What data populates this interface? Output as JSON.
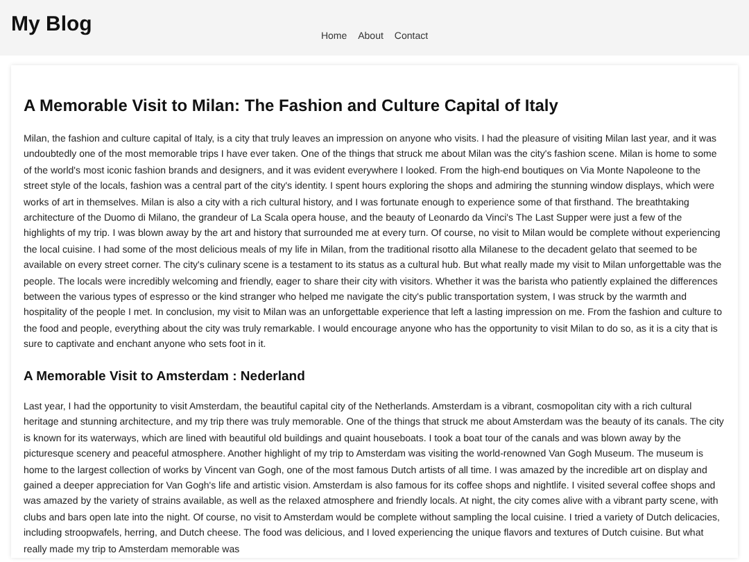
{
  "site_title": "My Blog",
  "nav": [
    {
      "label": "Home"
    },
    {
      "label": "About"
    },
    {
      "label": "Contact"
    }
  ],
  "posts": [
    {
      "title": "A Memorable Visit to Milan: The Fashion and Culture Capital of Italy",
      "body": "Milan, the fashion and culture capital of Italy, is a city that truly leaves an impression on anyone who visits. I had the pleasure of visiting Milan last year, and it was undoubtedly one of the most memorable trips I have ever taken. One of the things that struck me about Milan was the city's fashion scene. Milan is home to some of the world's most iconic fashion brands and designers, and it was evident everywhere I looked. From the high-end boutiques on Via Monte Napoleone to the street style of the locals, fashion was a central part of the city's identity. I spent hours exploring the shops and admiring the stunning window displays, which were works of art in themselves. Milan is also a city with a rich cultural history, and I was fortunate enough to experience some of that firsthand. The breathtaking architecture of the Duomo di Milano, the grandeur of La Scala opera house, and the beauty of Leonardo da Vinci's The Last Supper were just a few of the highlights of my trip. I was blown away by the art and history that surrounded me at every turn. Of course, no visit to Milan would be complete without experiencing the local cuisine. I had some of the most delicious meals of my life in Milan, from the traditional risotto alla Milanese to the decadent gelato that seemed to be available on every street corner. The city's culinary scene is a testament to its status as a cultural hub. But what really made my visit to Milan unforgettable was the people. The locals were incredibly welcoming and friendly, eager to share their city with visitors. Whether it was the barista who patiently explained the differences between the various types of espresso or the kind stranger who helped me navigate the city's public transportation system, I was struck by the warmth and hospitality of the people I met. In conclusion, my visit to Milan was an unforgettable experience that left a lasting impression on me. From the fashion and culture to the food and people, everything about the city was truly remarkable. I would encourage anyone who has the opportunity to visit Milan to do so, as it is a city that is sure to captivate and enchant anyone who sets foot in it."
    },
    {
      "title": "A Memorable Visit to Amsterdam : Nederland",
      "body": "Last year, I had the opportunity to visit Amsterdam, the beautiful capital city of the Netherlands. Amsterdam is a vibrant, cosmopolitan city with a rich cultural heritage and stunning architecture, and my trip there was truly memorable. One of the things that struck me about Amsterdam was the beauty of its canals. The city is known for its waterways, which are lined with beautiful old buildings and quaint houseboats. I took a boat tour of the canals and was blown away by the picturesque scenery and peaceful atmosphere. Another highlight of my trip to Amsterdam was visiting the world-renowned Van Gogh Museum. The museum is home to the largest collection of works by Vincent van Gogh, one of the most famous Dutch artists of all time. I was amazed by the incredible art on display and gained a deeper appreciation for Van Gogh's life and artistic vision. Amsterdam is also famous for its coffee shops and nightlife. I visited several coffee shops and was amazed by the variety of strains available, as well as the relaxed atmosphere and friendly locals. At night, the city comes alive with a vibrant party scene, with clubs and bars open late into the night. Of course, no visit to Amsterdam would be complete without sampling the local cuisine. I tried a variety of Dutch delicacies, including stroopwafels, herring, and Dutch cheese. The food was delicious, and I loved experiencing the unique flavors and textures of Dutch cuisine. But what really made my trip to Amsterdam memorable was"
    }
  ]
}
